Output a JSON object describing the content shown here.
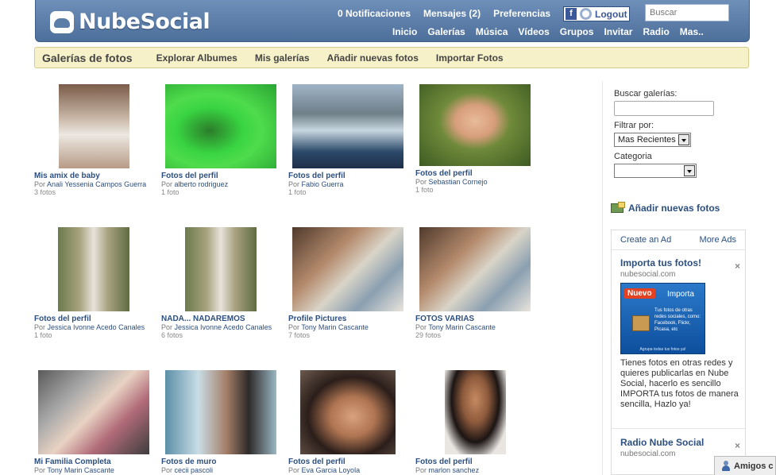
{
  "brand": {
    "name": "NubeSocial"
  },
  "topbar": {
    "links": [
      "0 Notificaciones",
      "Mensajes (2)",
      "Preferencias"
    ],
    "logout_label": "Logout",
    "search_placeholder": "Buscar",
    "nav": [
      "Inicio",
      "Galerías",
      "Música",
      "Vídeos",
      "Grupos",
      "Invitar",
      "Radio",
      "Mas.."
    ]
  },
  "subbar": {
    "title": "Galerías de fotos",
    "links": [
      "Explorar Albumes",
      "Mis galerías",
      "Añadir nuevas fotos",
      "Importar Fotos"
    ]
  },
  "albums": [
    {
      "title": "Mis amix de baby",
      "by": "Por",
      "author": "Anali Yessenia Campos Guerra",
      "count": "3 fotos"
    },
    {
      "title": "Fotos del perfil",
      "by": "Por",
      "author": "alberto rodriguez",
      "count": "1 foto"
    },
    {
      "title": "Fotos del perfil",
      "by": "Por",
      "author": "Fabio Guerra",
      "count": "1 foto"
    },
    {
      "title": "Fotos del perfil",
      "by": "Por",
      "author": "Sebastian Cornejo",
      "count": "1 foto"
    },
    {
      "title": "Fotos del perfil",
      "by": "Por",
      "author": "Jessica Ivonne Acedo Canales",
      "count": "1 foto"
    },
    {
      "title": "NADA... NADAREMOS",
      "by": "Por",
      "author": "Jessica Ivonne Acedo Canales",
      "count": "6 fotos"
    },
    {
      "title": "Profile Pictures",
      "by": "Por",
      "author": "Tony Marin Cascante",
      "count": "7 fotos"
    },
    {
      "title": "FOTOS VARIAS",
      "by": "Por",
      "author": "Tony Marin Cascante",
      "count": "29 fotos"
    },
    {
      "title": "Mi Familia Completa",
      "by": "Por",
      "author": "Tony Marin Cascante",
      "count": ""
    },
    {
      "title": "Fotos de muro",
      "by": "Por",
      "author": "cecii pascoli",
      "count": ""
    },
    {
      "title": "Fotos del perfil",
      "by": "Por",
      "author": "Eva Garcia Loyola",
      "count": ""
    },
    {
      "title": "Fotos del perfil",
      "by": "Por",
      "author": "marlon sanchez",
      "count": ""
    }
  ],
  "sidebar": {
    "search_label": "Buscar galerías:",
    "filter_label": "Filtrar por:",
    "filter_value": "Mas Recientes",
    "category_label": "Categoria",
    "category_value": "",
    "add_photos_label": "Añadir nuevas fotos"
  },
  "ads": {
    "create_label": "Create an Ad",
    "more_label": "More Ads",
    "items": [
      {
        "title": "Importa tus fotos!",
        "domain": "nubesocial.com",
        "close": "×",
        "image_badge": "Nuevo",
        "image_heading": "Importa",
        "image_text": "Tus fotos de otras redes sociales, como: Facebook, Flickr, Picasa, etc",
        "image_footer": "Agrupa todas tus fotos ya!",
        "body": "Tienes fotos en otras redes y quieres publicarlas en Nube Social, hacerlo es sencillo IMPORTA tus fotos de manera sencilla, Hazlo ya!"
      },
      {
        "title": "Radio Nube Social",
        "domain": "nubesocial.com",
        "close": "×"
      }
    ]
  },
  "chat": {
    "label": "Amigos c"
  },
  "colors": {
    "header": "#5b7ea9",
    "subbar": "#f6f1c8",
    "link": "#2c4f80"
  },
  "icons": {
    "logo": "cloud-icon",
    "facebook": "facebook-icon",
    "add_photos": "photo-icon",
    "chat": "person-icon"
  }
}
